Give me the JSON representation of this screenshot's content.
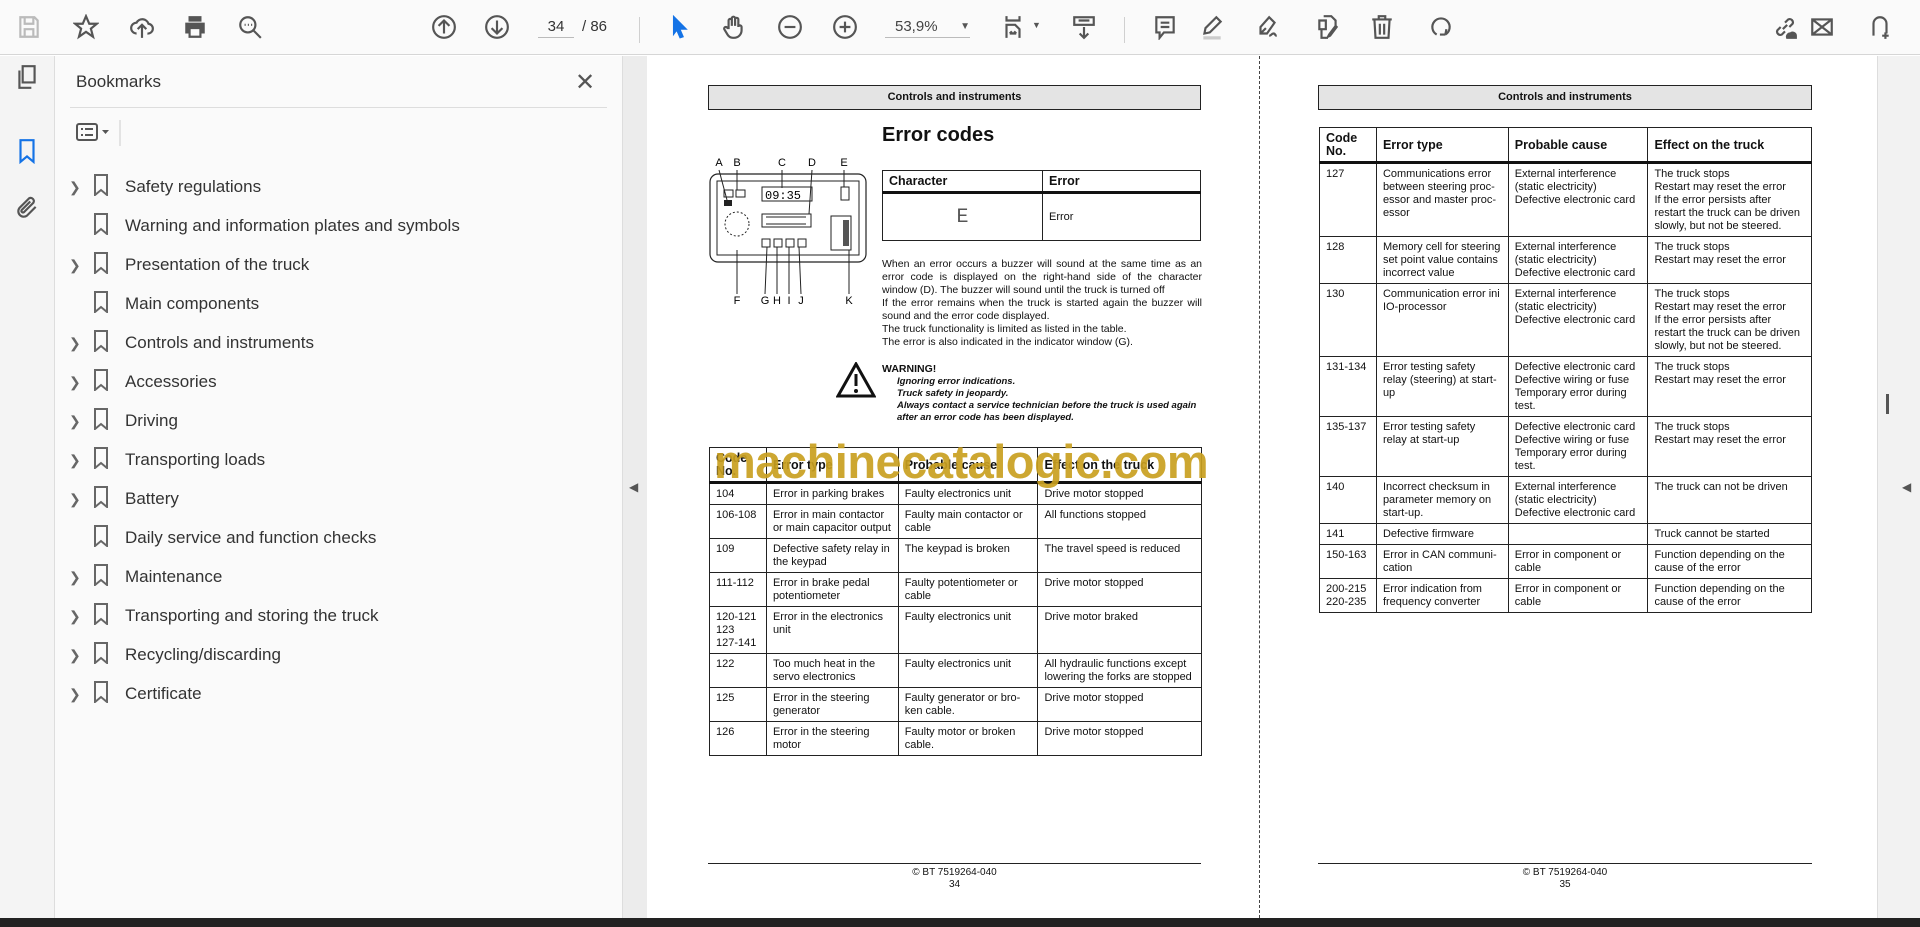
{
  "toolbar": {
    "page_current": "34",
    "page_total": "/ 86",
    "zoom": "53,9%"
  },
  "bookmarks": {
    "title": "Bookmarks",
    "close": "✕",
    "items": [
      {
        "label": "Safety regulations",
        "expandable": true
      },
      {
        "label": "Warning and information plates and symbols",
        "expandable": false
      },
      {
        "label": "Presentation of the truck",
        "expandable": true
      },
      {
        "label": "Main components",
        "expandable": false
      },
      {
        "label": "Controls and instruments",
        "expandable": true
      },
      {
        "label": "Accessories",
        "expandable": true
      },
      {
        "label": "Driving",
        "expandable": true
      },
      {
        "label": "Transporting loads",
        "expandable": true
      },
      {
        "label": "Battery",
        "expandable": true
      },
      {
        "label": "Daily service and function checks",
        "expandable": false
      },
      {
        "label": "Maintenance",
        "expandable": true
      },
      {
        "label": "Transporting and storing the truck",
        "expandable": true
      },
      {
        "label": "Recycling/discarding",
        "expandable": true
      },
      {
        "label": "Certificate",
        "expandable": true
      }
    ]
  },
  "left_page": {
    "header": "Controls and instruments",
    "title": "Error codes",
    "diagram": {
      "labels_top": [
        "A",
        "B",
        "C",
        "D",
        "E"
      ],
      "labels_bottom": [
        "F",
        "G",
        "H",
        "I",
        "J",
        "K"
      ],
      "clock": "09:35"
    },
    "char_table": {
      "headers": [
        "Character",
        "Error"
      ],
      "char": "E",
      "error": "Error"
    },
    "paragraph": [
      "When an error occurs a buzzer will sound at the same time as an error code is displayed on the right-hand side of the character window (D). The buzzer will sound until the truck is turned off",
      "If the error remains when the truck is started again the buzzer will sound and the error code displayed.",
      "The truck functionality is limited as listed in the table.",
      "The error is also indicated in the indicator window (G)."
    ],
    "warning": {
      "title": "WARNING!",
      "lines": [
        "Ignoring error indications.",
        "Truck safety in jeopardy.",
        "Always contact a service technician before the truck is used again after an error code has been displayed."
      ]
    },
    "table": {
      "headers": [
        "Code No.",
        "Error type",
        "Probable cause",
        "Effect on the truck"
      ],
      "rows": [
        [
          "104",
          "Error in parking brakes",
          "Faulty electronics unit",
          "Drive motor stopped"
        ],
        [
          "106-108",
          "Error in main contactor or main capacitor output",
          "Faulty main contactor or cable",
          "All functions stopped"
        ],
        [
          "109",
          "Defective safety relay in the keypad",
          "The keypad is broken",
          "The travel speed is reduced"
        ],
        [
          "111-112",
          "Error in brake pedal potentiometer",
          "Faulty potentiometer or cable",
          "Drive motor stopped"
        ],
        [
          "120-121\n123\n127-141",
          "Error in the electronics unit",
          "Faulty electronics unit",
          "Drive motor braked"
        ],
        [
          "122",
          "Too much heat in the servo electronics",
          "Faulty electronics unit",
          "All hydraulic functions except lowering the forks are stopped"
        ],
        [
          "125",
          "Error in the steering generator",
          "Faulty generator or bro-ken cable.",
          "Drive motor stopped"
        ],
        [
          "126",
          "Error in the steering motor",
          "Faulty motor or broken cable.",
          "Drive motor stopped"
        ]
      ]
    },
    "footer": {
      "doc": "© BT 7519264-040",
      "page": "34"
    }
  },
  "watermark": "machinecatalogic.com",
  "right_page": {
    "header": "Controls and instruments",
    "table": {
      "headers": [
        "Code No.",
        "Error type",
        "Probable cause",
        "Effect on the truck"
      ],
      "rows": [
        [
          "127",
          "Communications error between steering proc-essor and master proc-essor",
          "External interference\n(static electricity)\nDefective electronic card",
          "The truck stops\nRestart may reset the error\nIf the error persists after restart the truck can be driven slowly, but not be steered."
        ],
        [
          "128",
          "Memory cell for steering set point value contains incorrect value",
          "External interference\n(static electricity)\nDefective electronic card",
          "The truck stops\nRestart may reset the error"
        ],
        [
          "130",
          "Communication error ini IO-processor",
          "External interference\n(static electricity)\nDefective electronic card",
          "The truck stops\nRestart may reset the error\nIf the error persists after restart the truck can be driven slowly, but not be steered."
        ],
        [
          "131-134",
          "Error testing safety relay (steering) at start-up",
          "Defective electronic card\nDefective wiring or fuse\nTemporary error during test.",
          "The truck stops\nRestart may reset the error"
        ],
        [
          "135-137",
          "Error testing safety relay at start-up",
          "Defective electronic card\nDefective wiring or fuse\nTemporary error during test.",
          "The truck stops\nRestart may reset the error"
        ],
        [
          "140",
          "Incorrect checksum in parameter memory on start-up.",
          "External interference\n(static electricity)\nDefective electronic card",
          "The truck can not be driven"
        ],
        [
          "141",
          "Defective firmware",
          "",
          "Truck cannot be started"
        ],
        [
          "150-163",
          "Error in CAN communi-cation",
          "Error in component or cable",
          "Function depending on the cause of the error"
        ],
        [
          "200-215\n220-235",
          "Error indication from frequency converter",
          "Error in component or cable",
          "Function depending on the cause of the error"
        ]
      ]
    },
    "footer": {
      "doc": "© BT 7519264-040",
      "page": "35"
    }
  },
  "colors": {
    "accent": "#1473e6",
    "watermark": "#c9a020"
  }
}
